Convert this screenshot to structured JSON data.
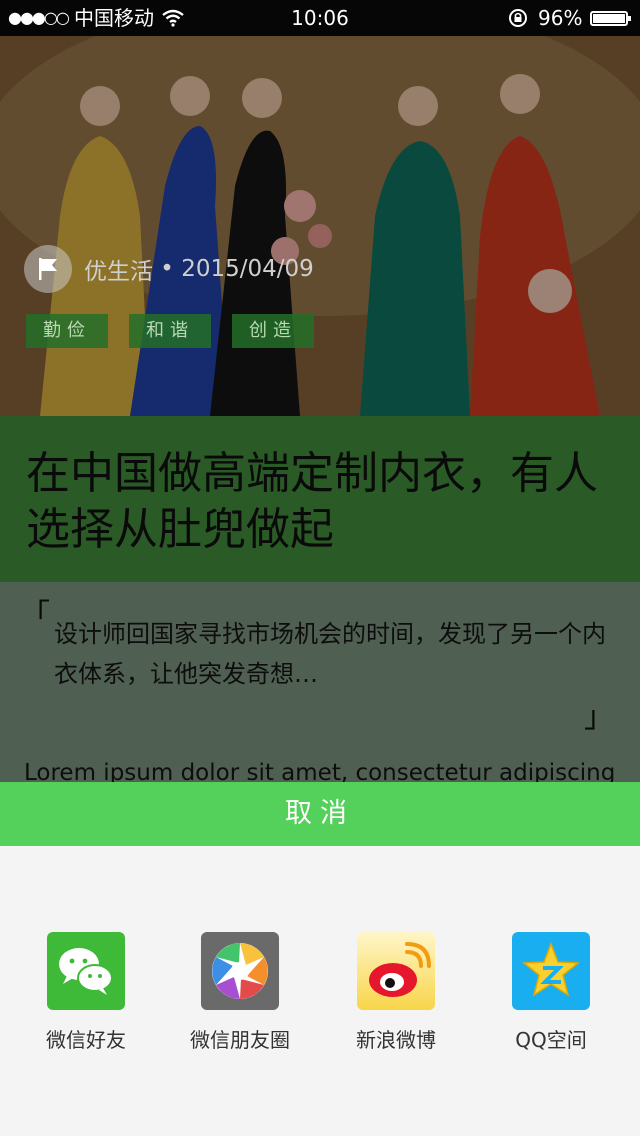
{
  "status_bar": {
    "signal": "●●●○○",
    "carrier": "中国移动",
    "time": "10:06",
    "battery": "96%"
  },
  "article": {
    "author": "优生活",
    "date": "2015/04/09",
    "tags": [
      "勤俭",
      "和谐",
      "创造"
    ],
    "title": "在中国做高端定制内衣，有人选择从肚兜做起",
    "quote": "设计师回国家寻找市场机会的时间，发现了另一个内衣体系，让他突发奇想…",
    "body_preview": "Lorem ipsum dolor sit amet, consectetur adipiscing"
  },
  "share_sheet": {
    "cancel_label": "取消",
    "targets": [
      {
        "label": "微信好友",
        "icon": "wechat-icon"
      },
      {
        "label": "微信朋友圈",
        "icon": "moments-icon"
      },
      {
        "label": "新浪微博",
        "icon": "weibo-icon"
      },
      {
        "label": "QQ空间",
        "icon": "qzone-icon"
      }
    ]
  },
  "colors": {
    "cancel_bar": "#53d15a",
    "title_bg": "#2a5a26",
    "tag_bg": "#236e28"
  }
}
